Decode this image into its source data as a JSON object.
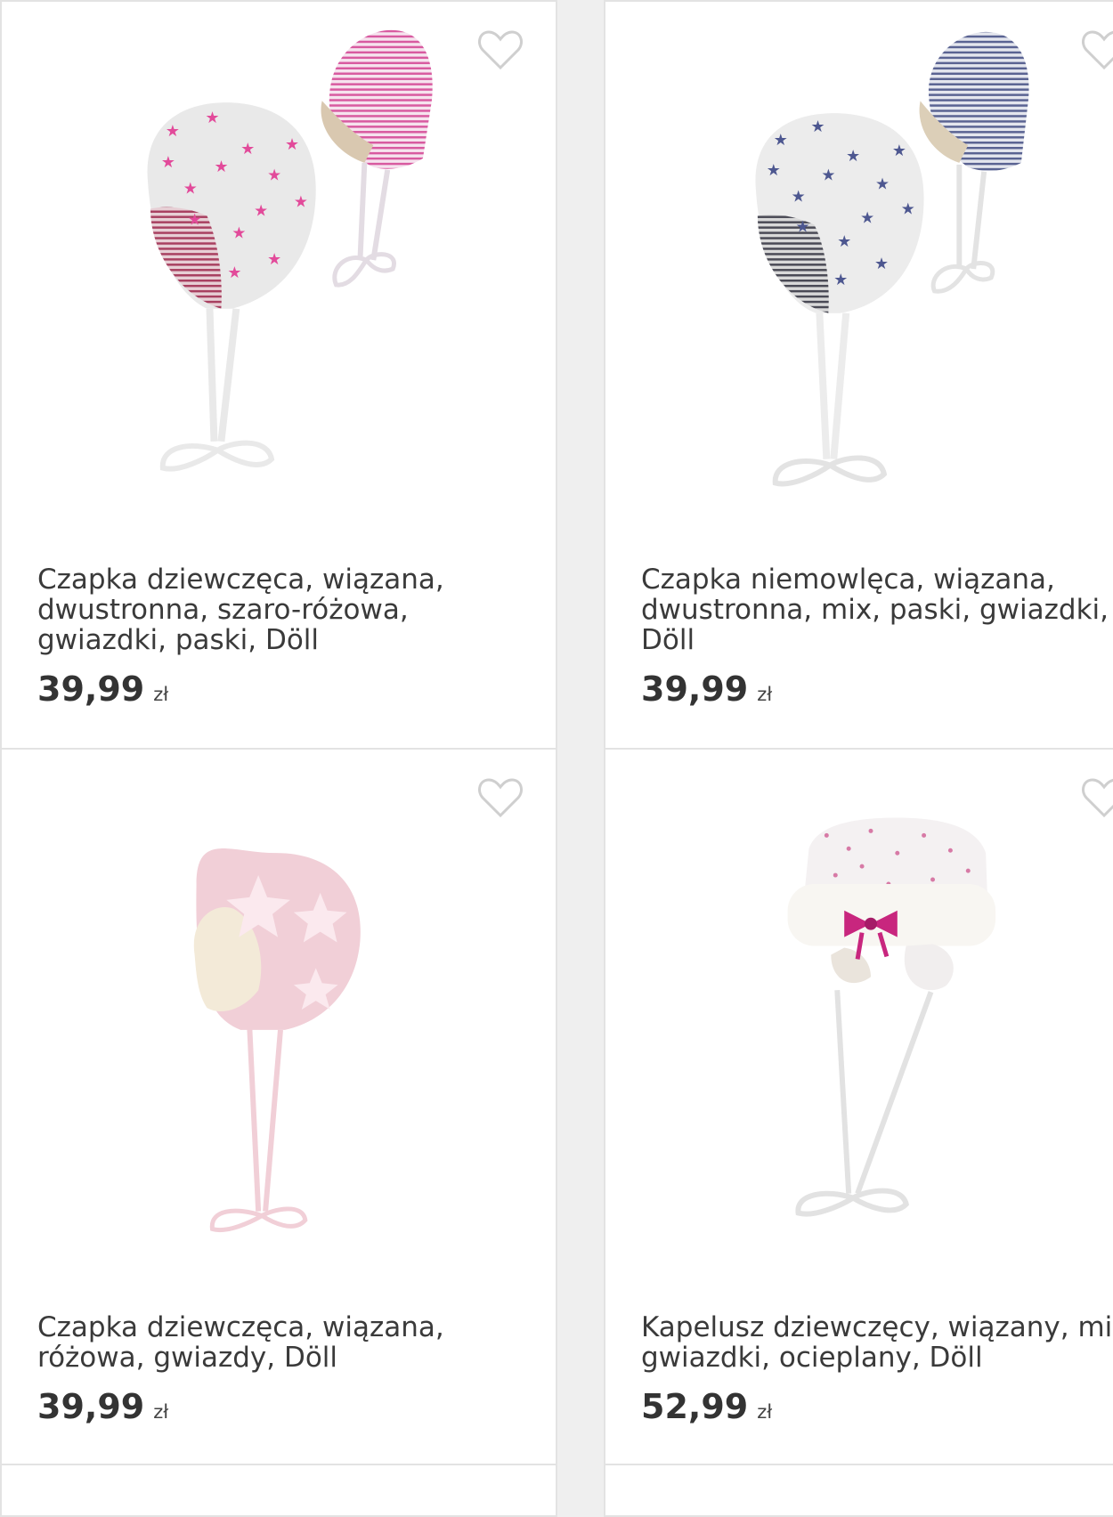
{
  "products": [
    {
      "title": "Czapka dziewczęca, wiązana, dwustronna, szaro-różowa, gwiazdki, paski, Döll",
      "price": "39,99",
      "currency": "zł",
      "favorite_icon": "heart-outline-icon",
      "image": "hat-grey-pink-stars-stripes"
    },
    {
      "title": "Czapka niemowlęca, wiązana, dwustronna, mix, paski, gwiazdki, Döll",
      "price": "39,99",
      "currency": "zł",
      "favorite_icon": "heart-outline-icon",
      "image": "hat-grey-navy-stars-stripes"
    },
    {
      "title": "Czapka dziewczęca, wiązana, różowa, gwiazdy, Döll",
      "price": "39,99",
      "currency": "zł",
      "favorite_icon": "heart-outline-icon",
      "image": "hat-pink-stars"
    },
    {
      "title": "Kapelusz dziewczęcy, wiązany, mix, gwiazdki, ocieplany, Döll",
      "price": "52,99",
      "currency": "zł",
      "favorite_icon": "heart-outline-icon",
      "image": "hat-white-fur-bow"
    }
  ],
  "colors": {
    "card_border": "#e3e3e3",
    "text": "#3a3a3a",
    "heart": "#cfcfcf"
  }
}
